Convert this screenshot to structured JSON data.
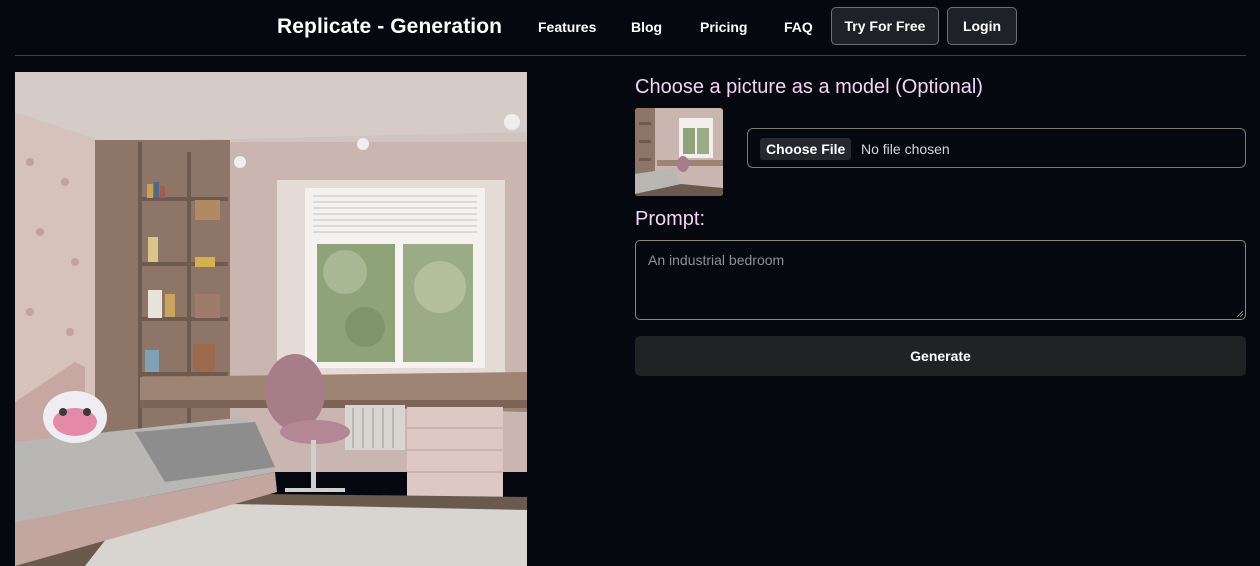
{
  "header": {
    "brand": "Replicate - Generation",
    "nav": {
      "features": "Features",
      "blog": "Blog",
      "pricing": "Pricing",
      "faq": "FAQ"
    },
    "try_free": "Try For Free",
    "login": "Login"
  },
  "model_section": {
    "heading": "Choose a picture as a model (Optional)",
    "file_button": "Choose File",
    "file_status": "No file chosen"
  },
  "prompt_section": {
    "heading": "Prompt:",
    "value": "",
    "placeholder": "An industrial bedroom"
  },
  "generate_button": "Generate",
  "colors": {
    "background": "#060810",
    "heading_pink": "#f2d4f2",
    "button_dark": "#212224"
  }
}
